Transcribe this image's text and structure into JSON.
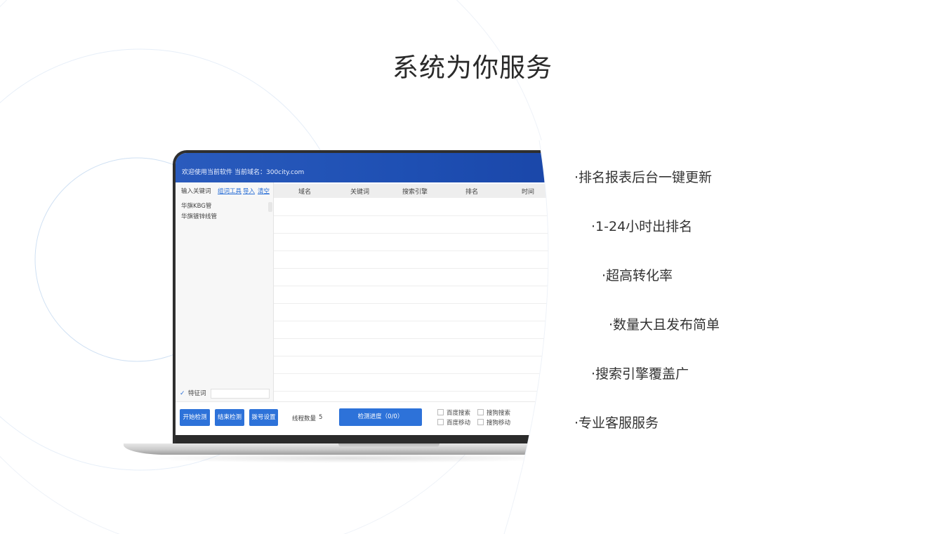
{
  "page": {
    "title": "系统为你服务"
  },
  "app": {
    "header_welcome": "欢迎使用当前软件",
    "header_domain": "当前域名：300city.com",
    "left_panel": {
      "heading": "输入关键词",
      "links": [
        "组词工具",
        "导入",
        "清空"
      ],
      "keywords": [
        "华旗KBG管",
        "华旗镀锌线管"
      ],
      "feature_word_label": "特征词"
    },
    "table": {
      "columns": [
        "域名",
        "关键词",
        "搜索引擎",
        "排名",
        "时间"
      ]
    },
    "bottom": {
      "buttons": [
        "开始检测",
        "结束检测",
        "拨号设置"
      ],
      "thread_label": "线程数量",
      "thread_value": "5",
      "progress_label": "检测进度（0/0）",
      "checkboxes": [
        "百度搜索",
        "搜狗搜索",
        "百度移动",
        "搜狗移动"
      ]
    }
  },
  "features": [
    "·排名报表后台一键更新",
    "·1-24小时出排名",
    "·超高转化率",
    "·数量大且发布简单",
    "·搜索引擎覆盖广",
    "·专业客服服务"
  ],
  "colors": {
    "accent": "#2d72d9",
    "header_blue": "#1e4fb3"
  }
}
